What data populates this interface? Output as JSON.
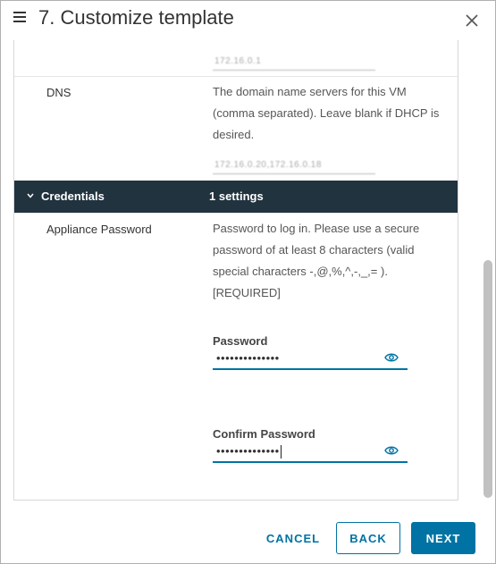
{
  "dialog": {
    "title": "7. Customize template"
  },
  "rows": {
    "gateway": {
      "value": "172.16.0.1"
    },
    "dns": {
      "label": "DNS",
      "description": "The domain name servers for this VM (comma separated). Leave blank if DHCP is desired.",
      "value": "172.16.0.20,172.16.0.18"
    }
  },
  "section": {
    "name": "Credentials",
    "count": "1 settings"
  },
  "appliance_password": {
    "label": "Appliance Password",
    "description": "Password to log in. Please use a secure password of at least 8 characters (valid special characters -,@,%,^,-,_,= ). [REQUIRED]",
    "password_label": "Password",
    "password_value": "••••••••••••••",
    "confirm_label": "Confirm Password",
    "confirm_value": "••••••••••••••"
  },
  "buttons": {
    "cancel": "CANCEL",
    "back": "BACK",
    "next": "NEXT"
  },
  "colors": {
    "accent": "#0072a3",
    "section_bar": "#21333f"
  },
  "icons": {
    "menu": "hamburger-icon",
    "close": "close-icon",
    "collapse": "chevron-down-icon",
    "reveal": "eye-icon"
  }
}
